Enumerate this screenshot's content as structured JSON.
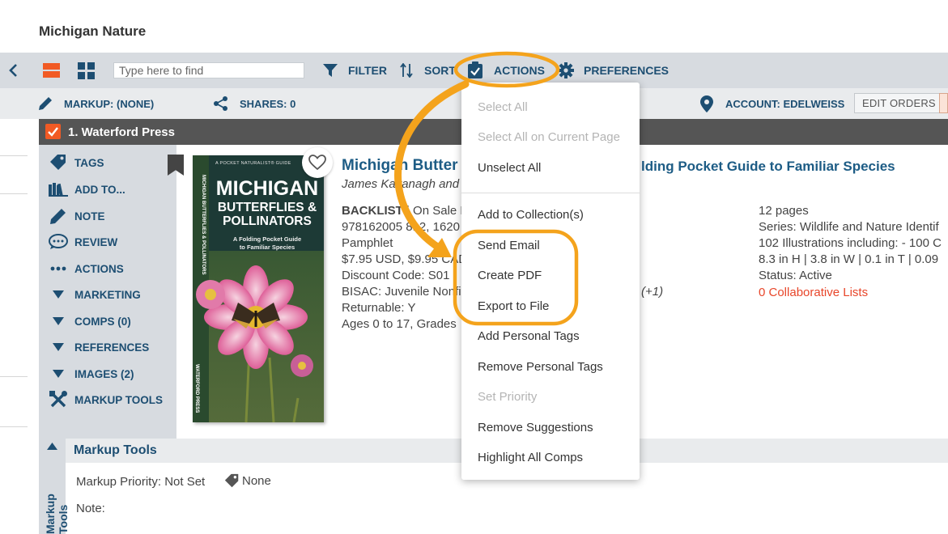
{
  "app": {
    "title": "Michigan Nature"
  },
  "toolbar": {
    "search_placeholder": "Type here to find",
    "filter_label": "FILTER",
    "sort_label": "SORT",
    "actions_label": "ACTIONS",
    "preferences_label": "PREFERENCES"
  },
  "subbar": {
    "markup_label": "MARKUP: (NONE)",
    "shares_label": "SHARES: 0",
    "account_label": "ACCOUNT: EDELWEISS",
    "edit_orders_label": "EDIT ORDERS"
  },
  "item": {
    "header_title": "1. Waterford Press",
    "title_visible": "Michigan Butter",
    "title_tail": "lding Pocket Guide to Familiar Species",
    "author": "James Kavanagh and",
    "details": [
      "BACKLIST | On Sale D",
      "978162005 812, 1620",
      "Pamphlet",
      "$7.95 USD, $9.95 CAD",
      "Discount Code: S01",
      "BISAC: Juvenile Nonfic",
      "Returnable: Y",
      "Ages 0 to 17, Grades"
    ],
    "mid_fragment": "(+1)",
    "right_details": [
      "12 pages",
      "Series: Wildlife and Nature Identif",
      "102 Illustrations including: - 100 C",
      "8.3 in H | 3.8 in W | 0.1 in T | 0.09",
      "Status: Active"
    ],
    "collab_link": "0 Collaborative Lists",
    "collab_color": "#e8462a"
  },
  "cover": {
    "series_line": "A POCKET NATURALIST® GUIDE",
    "title_line1": "MICHIGAN",
    "title_line2": "BUTTERFLIES &",
    "title_line3": "POLLINATORS",
    "subtitle_line1": "A Folding Pocket Guide",
    "subtitle_line2": "to Familiar Species",
    "spine_text": "MICHIGAN BUTTERFLIES & POLLINATORS",
    "publisher": "WATERFORD PRESS"
  },
  "side_menu": {
    "items": [
      {
        "label": "TAGS",
        "icon": "tag-icon"
      },
      {
        "label": "ADD TO...",
        "icon": "books-icon"
      },
      {
        "label": "NOTE",
        "icon": "pencil-icon"
      },
      {
        "label": "REVIEW",
        "icon": "speech-bubble-icon"
      },
      {
        "label": "ACTIONS",
        "icon": "ellipsis-icon"
      },
      {
        "label": "MARKETING",
        "icon": "triangle-down-icon"
      },
      {
        "label": "COMPS (0)",
        "icon": "triangle-down-icon"
      },
      {
        "label": "REFERENCES",
        "icon": "triangle-down-icon"
      },
      {
        "label": "IMAGES (2)",
        "icon": "triangle-down-icon"
      },
      {
        "label": "MARKUP TOOLS",
        "icon": "tools-icon"
      }
    ]
  },
  "markup_tools": {
    "header": "Markup Tools",
    "vertical_label": "Markup Tools",
    "priority_label": "Markup Priority: Not Set",
    "tag_value": "None",
    "note_label": "Note:"
  },
  "actions_menu": {
    "items": [
      {
        "label": "Select All",
        "disabled": true
      },
      {
        "label": "Select All on Current Page",
        "disabled": true
      },
      {
        "label": "Unselect All",
        "disabled": false
      },
      {
        "label": "Add to Collection(s)",
        "disabled": false
      },
      {
        "label": "Send Email",
        "disabled": false
      },
      {
        "label": "Create PDF",
        "disabled": false
      },
      {
        "label": "Export to File",
        "disabled": false
      },
      {
        "label": "Add Personal Tags",
        "disabled": false
      },
      {
        "label": "Remove Personal Tags",
        "disabled": false
      },
      {
        "label": "Set Priority",
        "disabled": true
      },
      {
        "label": "Remove Suggestions",
        "disabled": false
      },
      {
        "label": "Highlight All Comps",
        "disabled": false
      }
    ]
  },
  "colors": {
    "accent_orange": "#f15a24",
    "highlight_callout": "#f4a31c",
    "link_blue": "#1d5c85",
    "toolbar_bg": "#d7dbe0"
  }
}
